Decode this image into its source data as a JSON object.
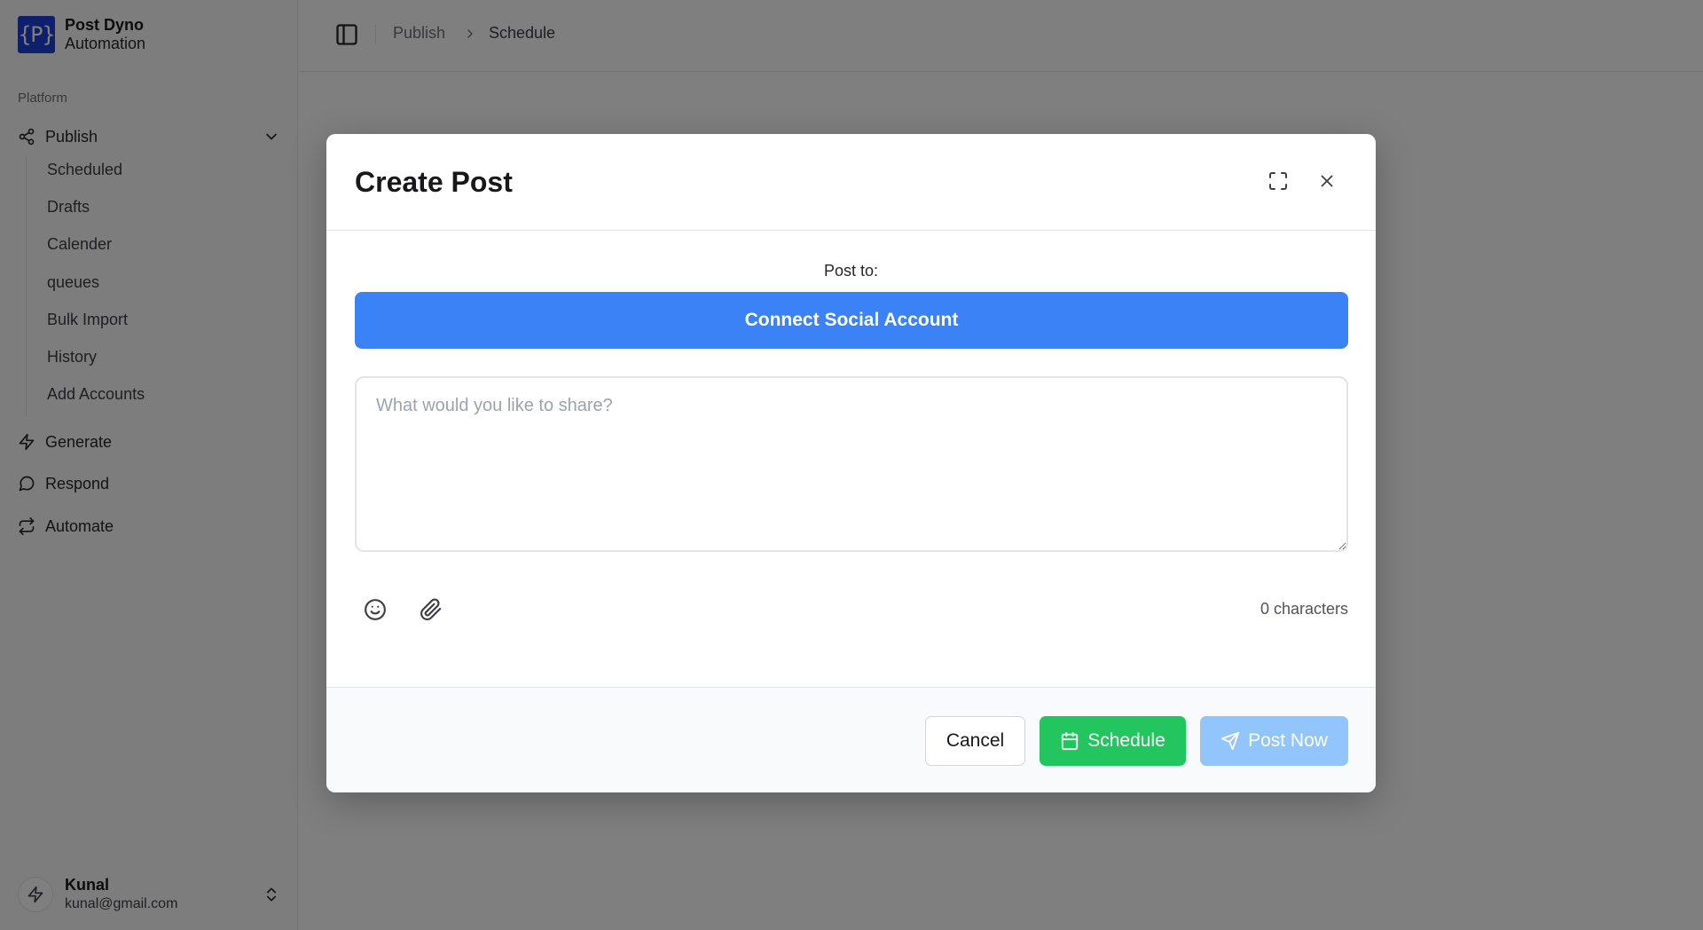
{
  "brand": {
    "logo_text": "{P}",
    "name": "Post Dyno",
    "subtitle": "Automation"
  },
  "sidebar": {
    "group_label": "Platform",
    "publish": {
      "label": "Publish",
      "items": [
        "Scheduled",
        "Drafts",
        "Calender",
        "queues",
        "Bulk Import",
        "History",
        "Add Accounts"
      ]
    },
    "nav": [
      {
        "label": "Generate",
        "icon": "zap-icon"
      },
      {
        "label": "Respond",
        "icon": "message-circle-icon"
      },
      {
        "label": "Automate",
        "icon": "repeat-icon"
      }
    ],
    "user": {
      "name": "Kunal",
      "email": "kunal@gmail.com"
    }
  },
  "header": {
    "breadcrumb": [
      "Publish",
      "Schedule"
    ]
  },
  "modal": {
    "title": "Create Post",
    "post_to_label": "Post to:",
    "connect_label": "Connect Social Account",
    "composer_placeholder": "What would you like to share?",
    "composer_value": "",
    "char_count": "0 characters",
    "cancel_label": "Cancel",
    "schedule_label": "Schedule",
    "post_now_label": "Post Now"
  },
  "colors": {
    "primary": "#3b82f6",
    "success": "#22c55e",
    "disabled_primary": "#93c5fd",
    "brand_logo": "#1d3fd8"
  }
}
